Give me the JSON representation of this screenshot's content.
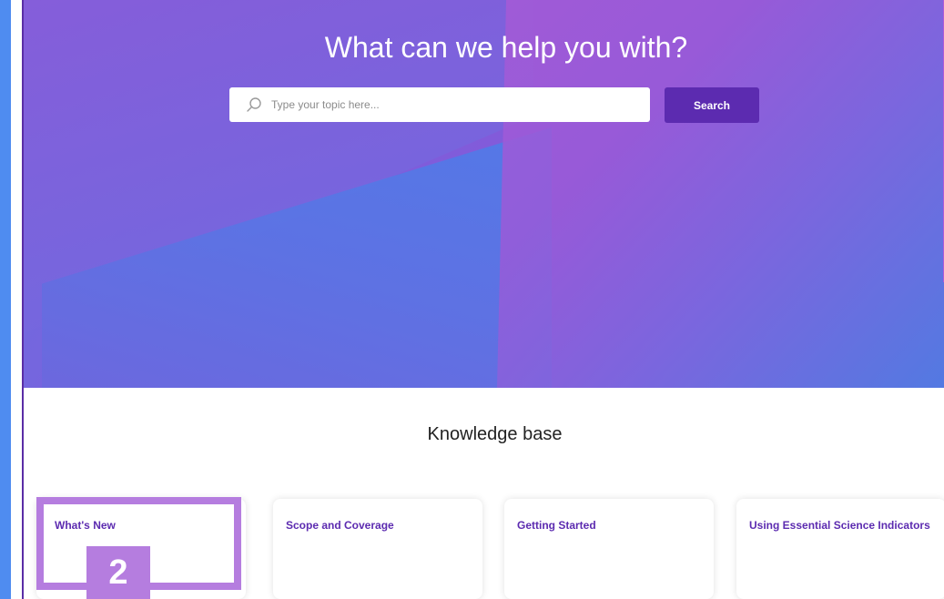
{
  "hero": {
    "title": "What can we help you with?",
    "search_placeholder": "Type your topic here...",
    "search_button": "Search"
  },
  "knowledge_base": {
    "title": "Knowledge base",
    "cards": [
      {
        "title": "What's New"
      },
      {
        "title": "Scope and Coverage"
      },
      {
        "title": "Getting Started"
      },
      {
        "title": "Using Essential Science Indicators"
      }
    ]
  },
  "annotation": {
    "badge": "2",
    "color": "#b57ddf"
  },
  "colors": {
    "accent": "#5c2bb0",
    "left_frame": "#4f8cf0"
  }
}
